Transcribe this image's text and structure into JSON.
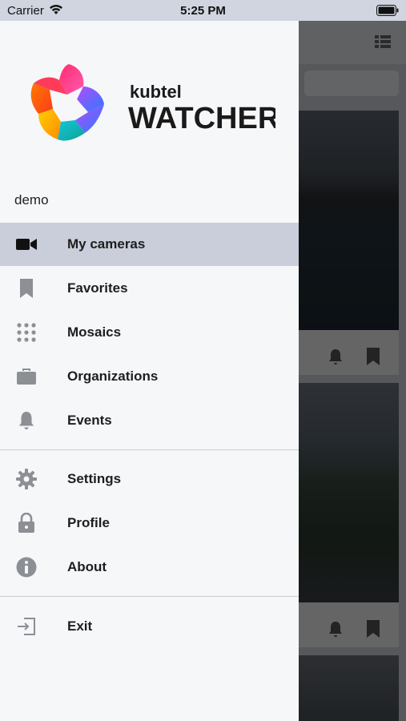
{
  "status_bar": {
    "carrier": "Carrier",
    "time": "5:25 PM"
  },
  "drawer": {
    "logo": {
      "brand_small": "kubtel",
      "brand_large": "WATCHER"
    },
    "username": "demo",
    "items": [
      {
        "label": "My cameras",
        "icon": "video-camera-icon",
        "active": true
      },
      {
        "label": "Favorites",
        "icon": "bookmark-icon"
      },
      {
        "label": "Mosaics",
        "icon": "grid-dots-icon"
      },
      {
        "label": "Organizations",
        "icon": "briefcase-icon"
      },
      {
        "label": "Events",
        "icon": "bell-icon"
      },
      {
        "label": "Settings",
        "icon": "gear-icon"
      },
      {
        "label": "Profile",
        "icon": "lock-icon"
      },
      {
        "label": "About",
        "icon": "info-icon"
      },
      {
        "label": "Exit",
        "icon": "exit-icon"
      }
    ]
  },
  "colors": {
    "drawer_bg": "#f6f7f9",
    "active_item_bg": "#c9ceda",
    "icon_gray": "#8c8f94",
    "status_bar_bg": "#d0d5e0"
  }
}
